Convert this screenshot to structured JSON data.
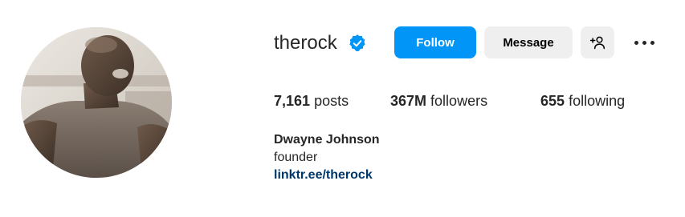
{
  "profile": {
    "username": "therock",
    "verified_icon": "verified-badge-icon",
    "full_name": "Dwayne Johnson",
    "bio": "founder",
    "link": "linktr.ee/therock",
    "avatar_icon": "profile-photo"
  },
  "actions": {
    "follow_label": "Follow",
    "message_label": "Message",
    "add_user_icon": "person-add-icon",
    "more_icon": "more-options-icon"
  },
  "stats": {
    "posts_count": "7,161",
    "posts_label": "posts",
    "followers_count": "367M",
    "followers_label": "followers",
    "following_count": "655",
    "following_label": "following"
  },
  "colors": {
    "accent": "#0095f6",
    "secondary_button": "#efefef",
    "link": "#00376b",
    "text": "#262626"
  }
}
